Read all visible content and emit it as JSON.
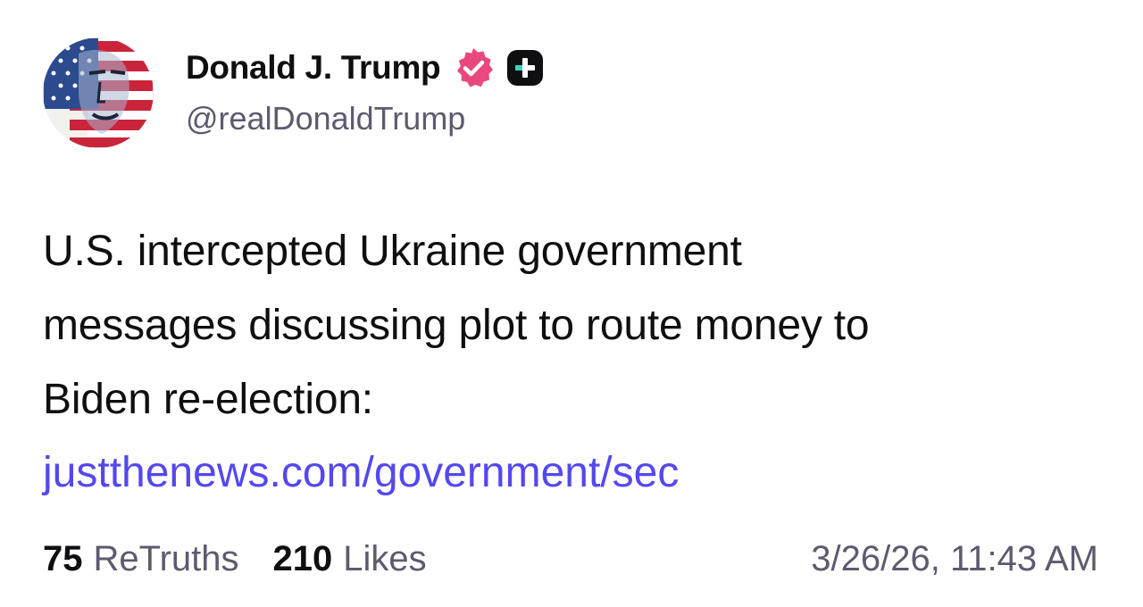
{
  "author": {
    "display_name": "Donald J. Trump",
    "handle": "@realDonaldTrump",
    "avatar_icon": "flag-portrait-avatar",
    "verified_icon": "verified-badge-icon",
    "extra_badge_icon": "truth-plus-badge-icon"
  },
  "post": {
    "lines": [
      "U.S. intercepted Ukraine government",
      "messages discussing plot to route money to",
      "Biden re-election:"
    ],
    "link_text": "justthenews.com/government/sec"
  },
  "stats": {
    "retruths_count": "75",
    "retruths_label": "ReTruths",
    "likes_count": "210",
    "likes_label": "Likes",
    "timestamp": "3/26/26, 11:43 AM"
  },
  "colors": {
    "link": "#5448ee",
    "muted": "#5c5b6e",
    "verified": "#e8487d",
    "badge": "#0f0f12",
    "badge_accent": "#3fd0c0"
  }
}
